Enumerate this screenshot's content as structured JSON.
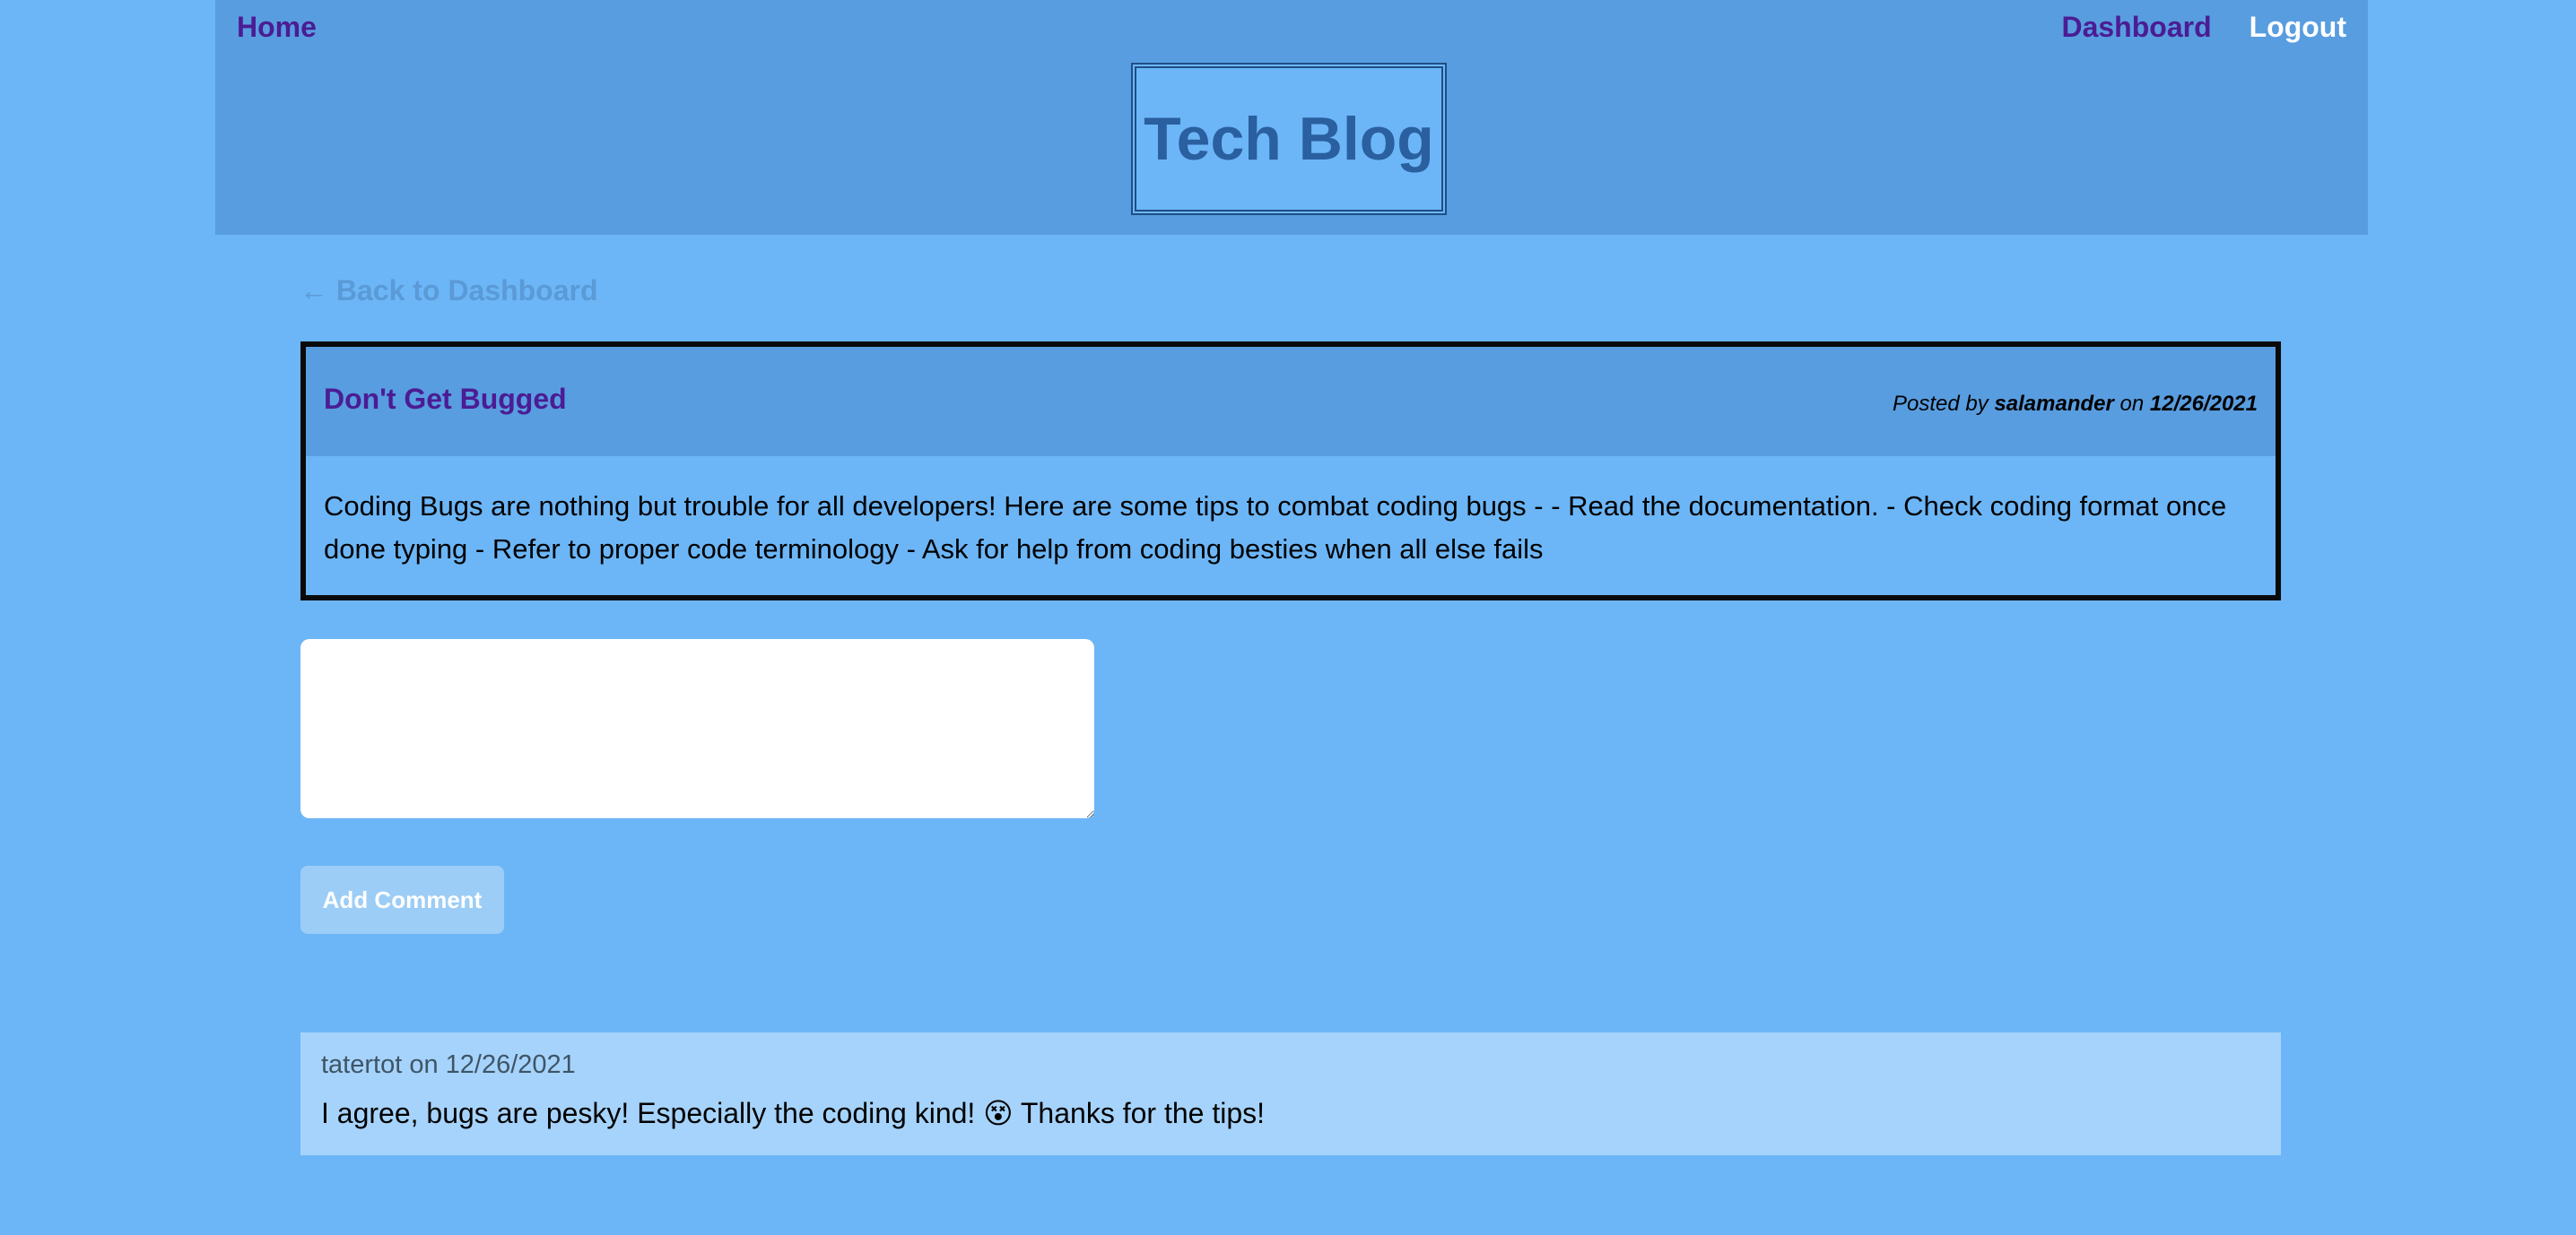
{
  "nav": {
    "home": "Home",
    "dashboard": "Dashboard",
    "logout": "Logout"
  },
  "site": {
    "title": "Tech Blog"
  },
  "back_link": "← Back to Dashboard",
  "post": {
    "title": "Don't Get Bugged",
    "meta_prefix": "Posted by ",
    "author": "salamander",
    "meta_on": " on ",
    "date": "12/26/2021",
    "body": "Coding Bugs are nothing but trouble for all developers! Here are some tips to combat coding bugs - - Read the documentation. - Check coding format once done typing - Refer to proper code terminology - Ask for help from coding besties when all else fails"
  },
  "comment_form": {
    "value": "",
    "button_label": "Add Comment"
  },
  "comments": [
    {
      "meta": "tatertot on 12/26/2021",
      "text": "I agree, bugs are pesky! Especially the coding kind! 😵 Thanks for the tips!"
    }
  ],
  "colors": {
    "background": "#6cb6f7",
    "header": "#589de0",
    "link_purple": "#4b1c94",
    "comment_bg": "#a6d3fb"
  }
}
